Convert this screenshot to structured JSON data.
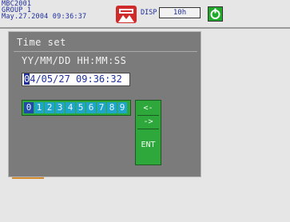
{
  "header": {
    "line1": "MBC2001",
    "line2": "GROUP 1",
    "line3": "May.27.2004 09:36:37",
    "disp_label": "DISP",
    "period": "10h"
  },
  "dialog": {
    "title": "Time set",
    "format": "YY/MM/DD HH:MM:SS",
    "value_first": "0",
    "value_rest": "4/05/27 09:36:32"
  },
  "keypad": {
    "digits": [
      "0",
      "1",
      "2",
      "3",
      "4",
      "5",
      "6",
      "7",
      "8",
      "9"
    ],
    "left": "<-",
    "right": "->",
    "enter": "ENT"
  }
}
